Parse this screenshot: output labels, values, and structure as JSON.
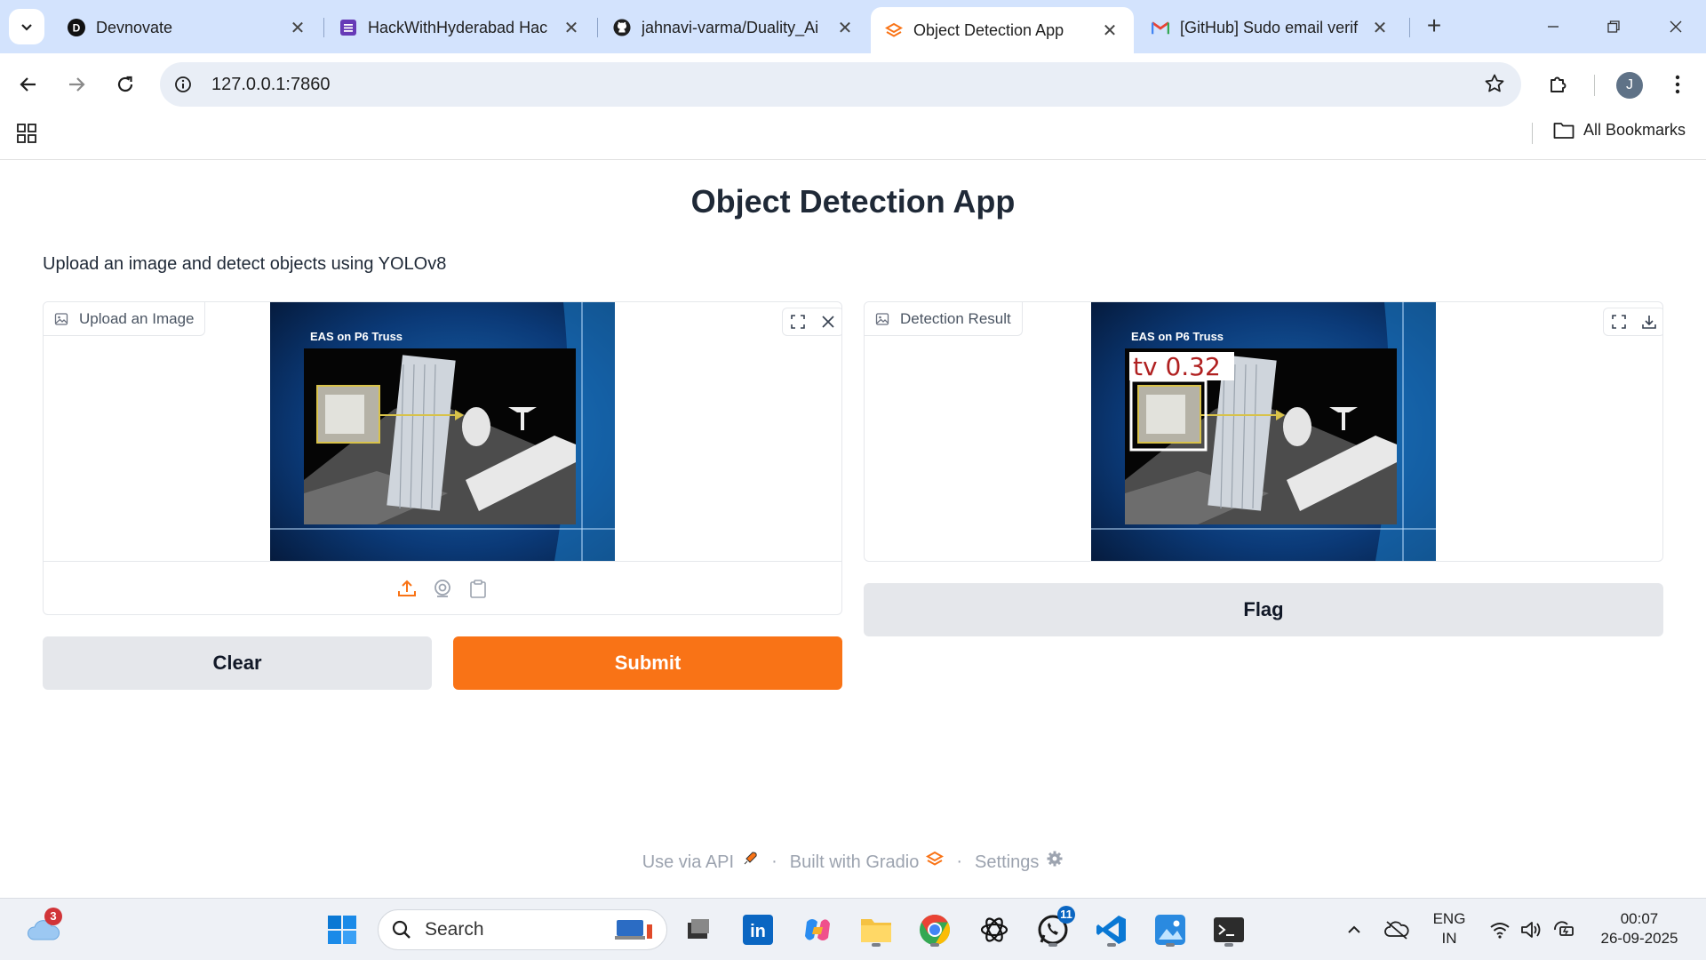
{
  "browser": {
    "tabs": [
      {
        "title": "Devnovate",
        "active": false
      },
      {
        "title": "HackWithHyderabad Hac",
        "active": false
      },
      {
        "title": "jahnavi-varma/Duality_Ai",
        "active": false
      },
      {
        "title": "Object Detection App",
        "active": true
      },
      {
        "title": "[GitHub] Sudo email verif",
        "active": false
      }
    ],
    "url": "127.0.0.1:7860",
    "avatar_letter": "J",
    "all_bookmarks_label": "All Bookmarks"
  },
  "app": {
    "title": "Object Detection App",
    "description": "Upload an image and detect objects using YOLOv8",
    "input_label": "Upload an Image",
    "output_label": "Detection Result",
    "clear_label": "Clear",
    "submit_label": "Submit",
    "flag_label": "Flag",
    "image_caption": "EAS on P6 Truss",
    "detection_label": "tv 0.32",
    "accent_color": "#f97316"
  },
  "footer": {
    "api": "Use via API",
    "built": "Built with Gradio",
    "settings": "Settings"
  },
  "taskbar": {
    "weather_badge": "3",
    "search_placeholder": "Search",
    "whatsapp_badge": "11",
    "lang_line1": "ENG",
    "lang_line2": "IN",
    "time": "00:07",
    "date": "26-09-2025"
  }
}
